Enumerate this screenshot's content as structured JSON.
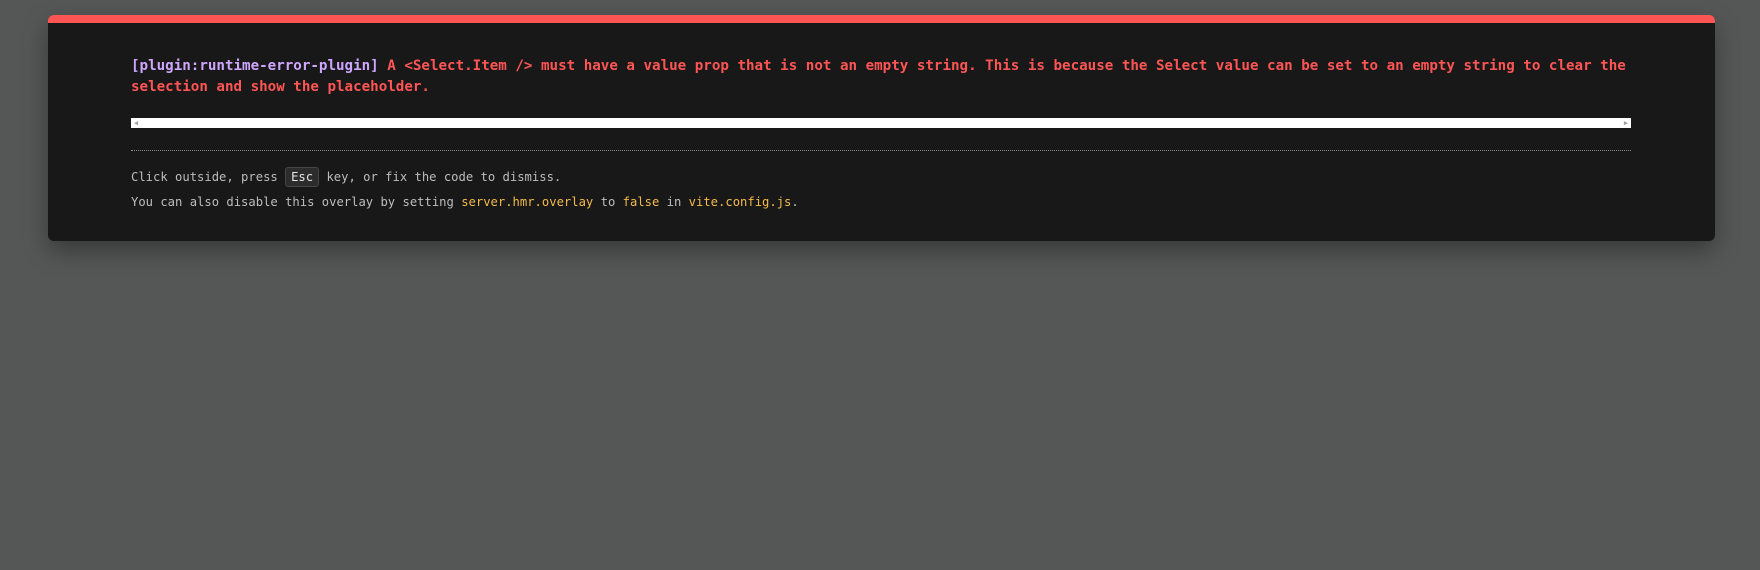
{
  "error": {
    "plugin": "[plugin:runtime-error-plugin]",
    "message": " A <Select.Item /> must have a value prop that is not an empty string. This is because the Select value can be set to an empty string to clear the selection and show the placeholder."
  },
  "tip": {
    "line1_before": "Click outside, press ",
    "key": "Esc",
    "line1_after": " key, or fix the code to dismiss.",
    "line2_before": "You can also disable this overlay by setting ",
    "setting": "server.hmr.overlay",
    "to_word": " to ",
    "value": "false",
    "in_word": " in ",
    "file": "vite.config.js",
    "period": "."
  },
  "colors": {
    "accent": "#ff5555",
    "plugin": "#cfa6ff",
    "code": "#f4bb4a",
    "backdrop": "#555756",
    "window": "#181818"
  },
  "icons": {
    "scroll_left": "scroll-left-arrow-icon",
    "scroll_right": "scroll-right-arrow-icon"
  }
}
